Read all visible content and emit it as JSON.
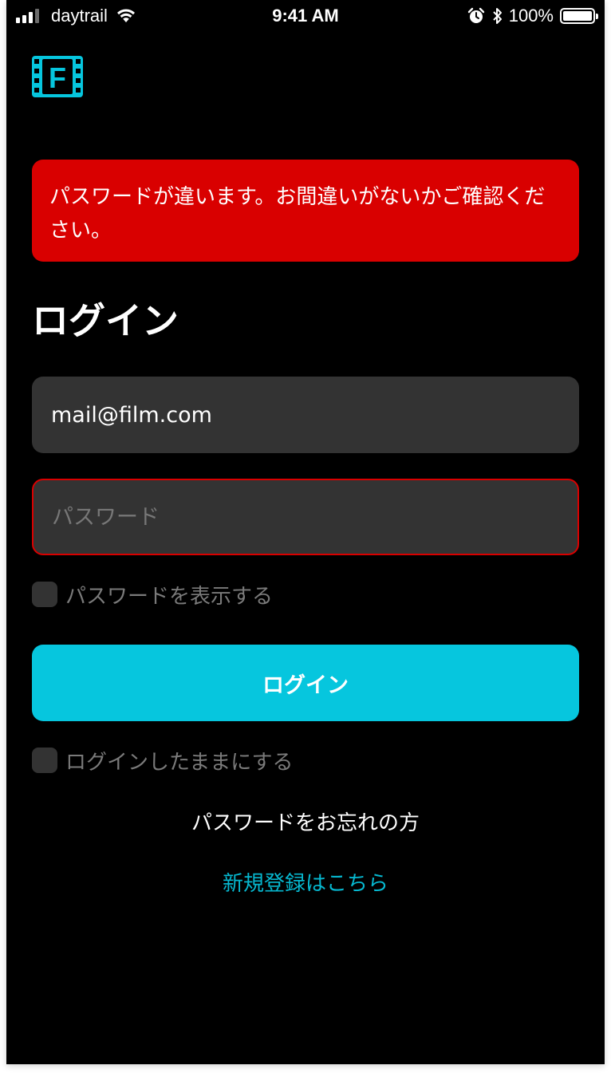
{
  "status_bar": {
    "carrier": "daytrail",
    "time": "9:41 AM",
    "battery": "100%"
  },
  "colors": {
    "accent": "#06c6de",
    "error": "#d90000",
    "field_bg": "#333333",
    "background": "#000000"
  },
  "logo": {
    "icon": "film-logo-icon",
    "letter": "F"
  },
  "error": {
    "message": "パスワードが違います。お間違いがないかご確認ください。"
  },
  "login": {
    "title": "ログイン",
    "email_value": "mail@film.com",
    "password_placeholder": "パスワード",
    "show_password_label": "パスワードを表示する",
    "submit_label": "ログイン",
    "stay_logged_in_label": "ログインしたままにする",
    "forgot_password_link": "パスワードをお忘れの方",
    "register_link": "新規登録はこちら"
  }
}
